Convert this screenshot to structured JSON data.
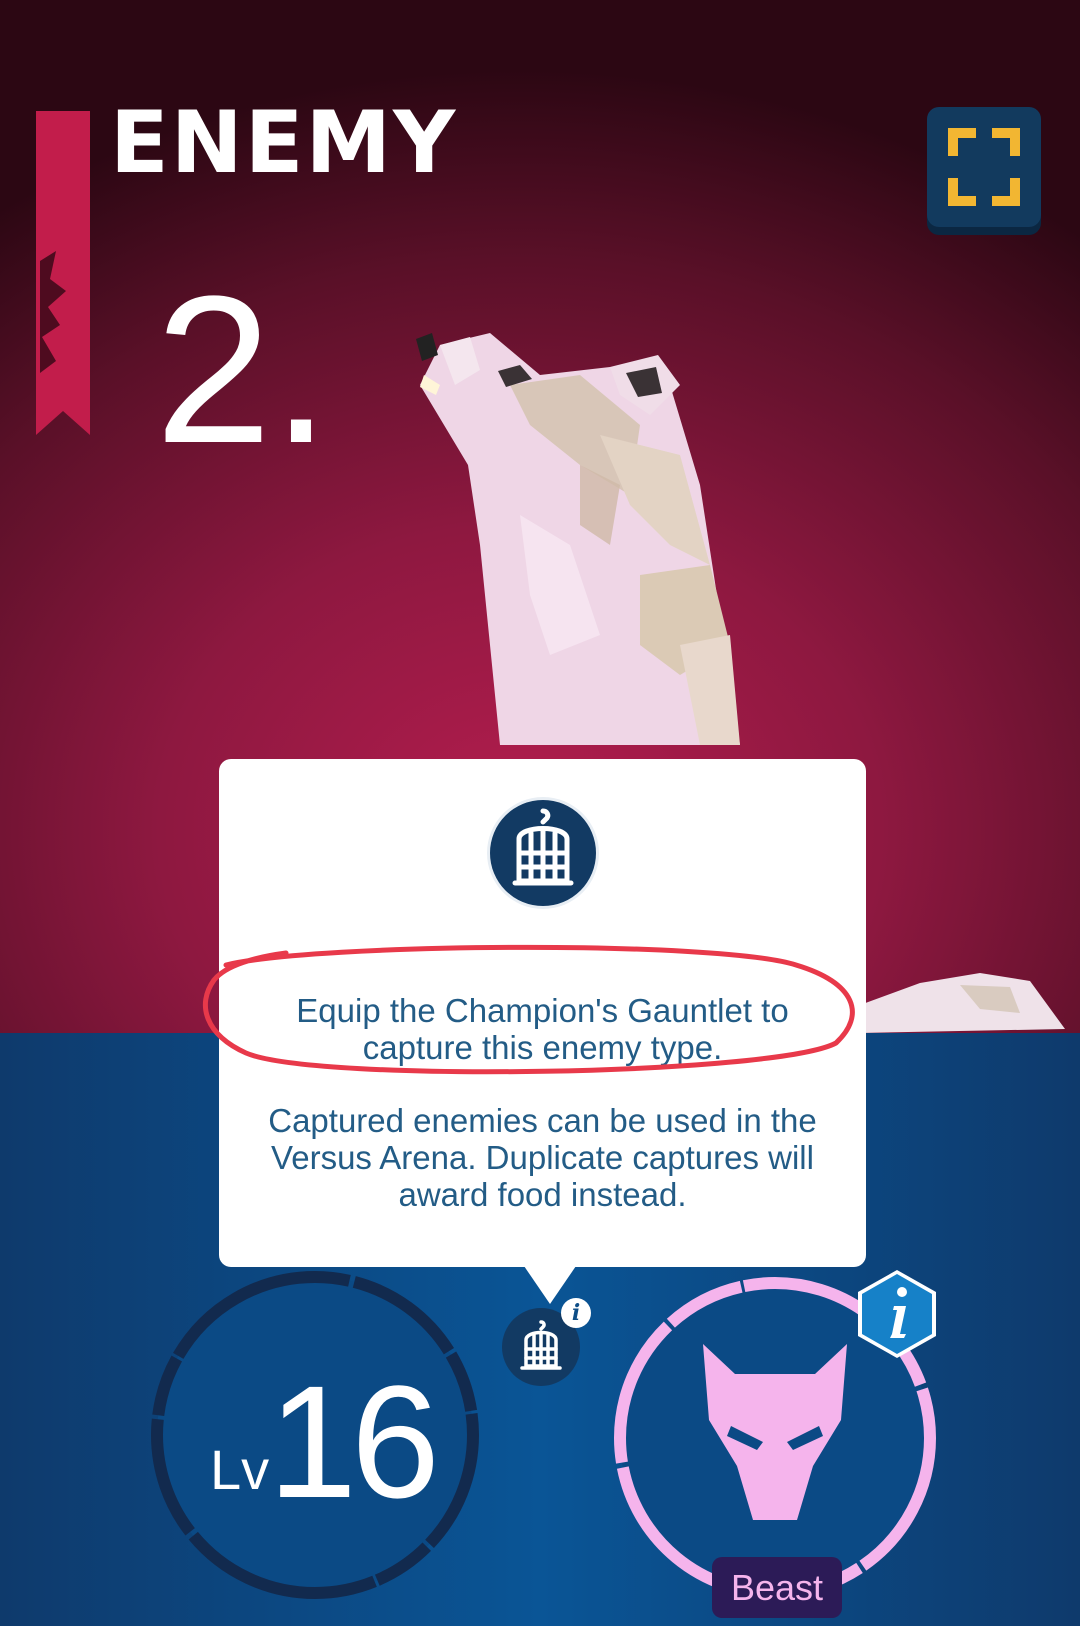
{
  "header": {
    "title": "ENEMY",
    "rank": "2."
  },
  "popup": {
    "icon": "birdcage-icon",
    "highlighted_text": "Equip the Champion's Gauntlet to capture this enemy type.",
    "description": "Captured enemies can be used in the Versus Arena. Duplicate captures will award food instead."
  },
  "stats": {
    "level_prefix": "Lv",
    "level": "16",
    "type_label": "Beast",
    "type_icon": "wolf-head-icon"
  },
  "icons": {
    "fullscreen": "fullscreen-corners-icon",
    "capture": "birdcage-icon",
    "info": "info-icon"
  },
  "colors": {
    "background_top": "#9a1b47",
    "background_bottom": "#0a4f8f",
    "popup_text": "#235c86",
    "highlight_ring": "#e8394a",
    "type_accent": "#f5b4ec",
    "fullscreen_corners": "#f2b632"
  }
}
